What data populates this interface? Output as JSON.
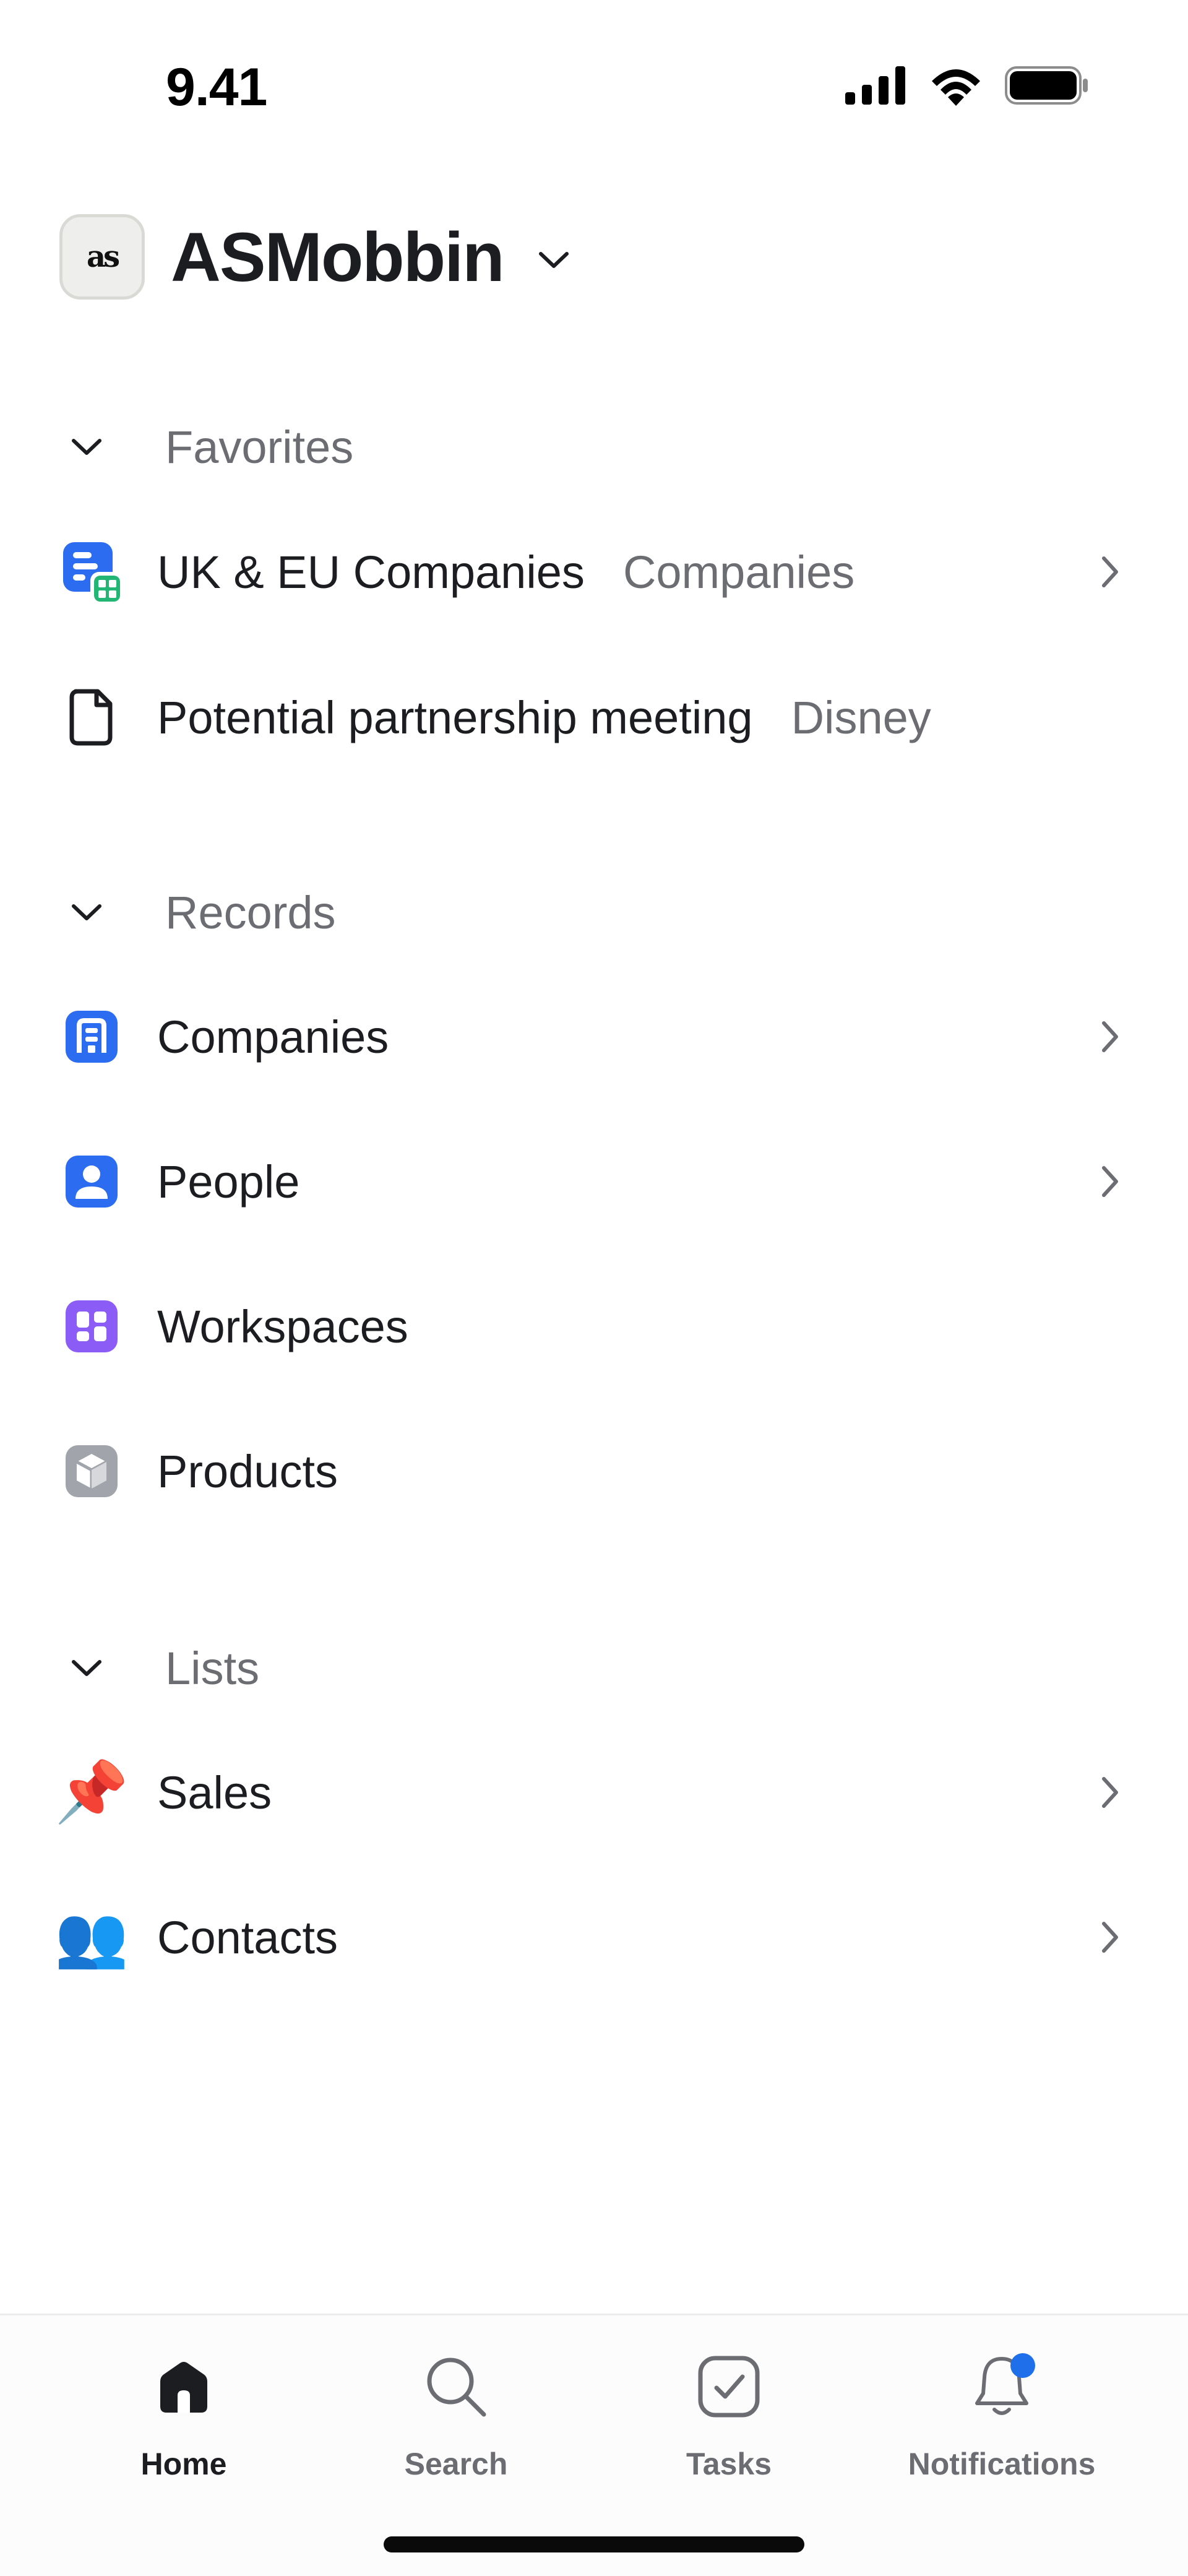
{
  "status_bar": {
    "time": "9.41"
  },
  "workspace": {
    "logo_text": "as",
    "name": "ASMobbin"
  },
  "favorites": {
    "title": "Favorites",
    "items": [
      {
        "label": "UK & EU Companies",
        "sub": "Companies",
        "icon": "companies-view-icon"
      },
      {
        "label": "Potential partnership meeting",
        "sub": "Disney",
        "icon": "document-icon"
      }
    ]
  },
  "records": {
    "title": "Records",
    "items": [
      {
        "label": "Companies",
        "icon": "companies-icon",
        "color": "#2b6cf0"
      },
      {
        "label": "People",
        "icon": "person-icon",
        "color": "#2b6cf0"
      },
      {
        "label": "Workspaces",
        "icon": "workspaces-icon",
        "color": "#8b5cf6"
      },
      {
        "label": "Products",
        "icon": "cube-icon",
        "color": "#9ca0a6"
      }
    ]
  },
  "lists": {
    "title": "Lists",
    "items": [
      {
        "label": "Sales",
        "emoji": "📌"
      },
      {
        "label": "Contacts",
        "emoji": "👥"
      }
    ]
  },
  "tab_bar": {
    "tabs": [
      {
        "label": "Home",
        "icon": "home-icon",
        "active": true
      },
      {
        "label": "Search",
        "icon": "search-icon"
      },
      {
        "label": "Tasks",
        "icon": "tasks-icon"
      },
      {
        "label": "Notifications",
        "icon": "bell-icon",
        "badge_color": "#1f6feb"
      }
    ]
  }
}
